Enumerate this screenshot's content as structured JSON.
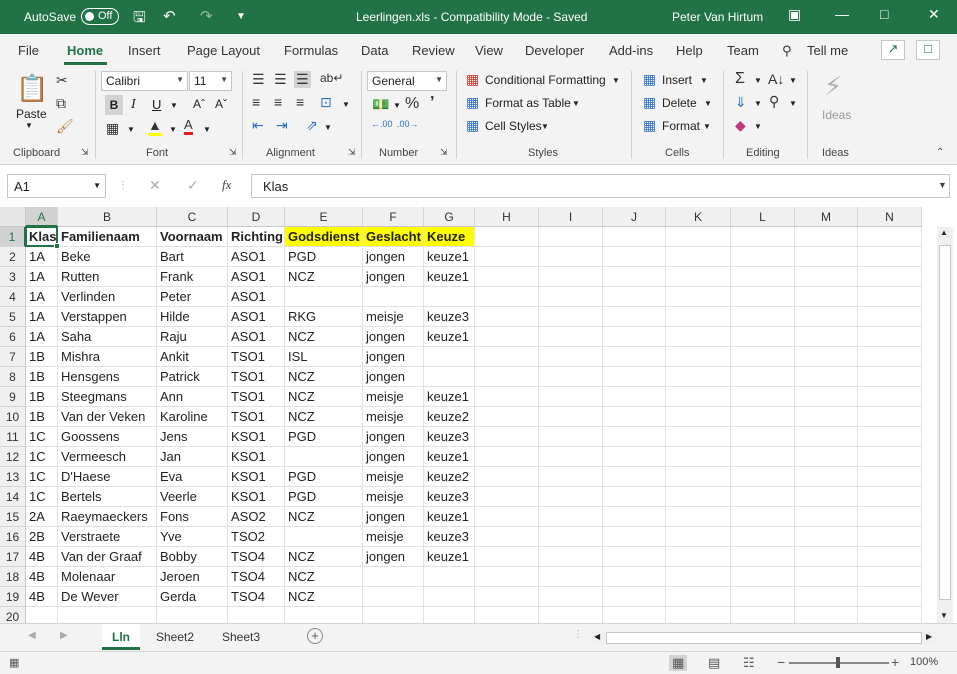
{
  "titlebar": {
    "autosave_label": "AutoSave",
    "autosave_state": "Off",
    "doc_title": "Leerlingen.xls  -  Compatibility Mode  -  Saved",
    "user": "Peter Van Hirtum"
  },
  "tabs": [
    "File",
    "Home",
    "Insert",
    "Page Layout",
    "Formulas",
    "Data",
    "Review",
    "View",
    "Developer",
    "Add-ins",
    "Help",
    "Team"
  ],
  "tell_me": "Tell me",
  "ribbon": {
    "clipboard": {
      "paste": "Paste",
      "label": "Clipboard"
    },
    "font": {
      "name": "Calibri",
      "size": "11",
      "bold": "B",
      "italic": "I",
      "underline": "U",
      "label": "Font"
    },
    "alignment": {
      "label": "Alignment"
    },
    "number": {
      "format": "General",
      "label": "Number"
    },
    "styles": {
      "conditional": "Conditional Formatting",
      "table": "Format as Table",
      "cell": "Cell Styles",
      "label": "Styles"
    },
    "cells": {
      "insert": "Insert",
      "delete": "Delete",
      "format": "Format",
      "label": "Cells"
    },
    "editing": {
      "label": "Editing"
    },
    "ideas": {
      "button": "Ideas",
      "label": "Ideas"
    }
  },
  "formula_bar": {
    "name_box": "A1",
    "content": "Klas"
  },
  "columns": [
    "A",
    "B",
    "C",
    "D",
    "E",
    "F",
    "G",
    "H",
    "I",
    "J",
    "K",
    "L",
    "M",
    "N"
  ],
  "rows": [
    "1",
    "2",
    "3",
    "4",
    "5",
    "6",
    "7",
    "8",
    "9",
    "10",
    "11",
    "12",
    "13",
    "14",
    "15",
    "16",
    "17",
    "18",
    "19",
    "20"
  ],
  "header_row": [
    "Klas",
    "Familienaam",
    "Voornaam",
    "Richting",
    "Godsdienst",
    "Geslacht",
    "Keuze"
  ],
  "data_rows": [
    [
      "1A",
      "Beke",
      "Bart",
      "ASO1",
      "PGD",
      "jongen",
      "keuze1"
    ],
    [
      "1A",
      "Rutten",
      "Frank",
      "ASO1",
      "NCZ",
      "jongen",
      "keuze1"
    ],
    [
      "1A",
      "Verlinden",
      "Peter",
      "ASO1",
      "",
      "",
      ""
    ],
    [
      "1A",
      "Verstappen",
      "Hilde",
      "ASO1",
      "RKG",
      "meisje",
      "keuze3"
    ],
    [
      "1A",
      "Saha",
      "Raju",
      "ASO1",
      "NCZ",
      "jongen",
      "keuze1"
    ],
    [
      "1B",
      "Mishra",
      "Ankit",
      "TSO1",
      "ISL",
      "jongen",
      ""
    ],
    [
      "1B",
      "Hensgens",
      "Patrick",
      "TSO1",
      "NCZ",
      "jongen",
      ""
    ],
    [
      "1B",
      "Steegmans",
      "Ann",
      "TSO1",
      "NCZ",
      "meisje",
      "keuze1"
    ],
    [
      "1B",
      "Van der Veken",
      "Karoline",
      "TSO1",
      "NCZ",
      "meisje",
      "keuze2"
    ],
    [
      "1C",
      "Goossens",
      "Jens",
      "KSO1",
      "PGD",
      "jongen",
      "keuze3"
    ],
    [
      "1C",
      "Vermeesch",
      "Jan",
      "KSO1",
      "",
      "jongen",
      "keuze1"
    ],
    [
      "1C",
      "D'Haese",
      "Eva",
      "KSO1",
      "PGD",
      "meisje",
      "keuze2"
    ],
    [
      "1C",
      "Bertels",
      "Veerle",
      "KSO1",
      "PGD",
      "meisje",
      "keuze3"
    ],
    [
      "2A",
      "Raeymaeckers",
      "Fons",
      "ASO2",
      "NCZ",
      "jongen",
      "keuze1"
    ],
    [
      "2B",
      "Verstraete",
      "Yve",
      "TSO2",
      "",
      "meisje",
      "keuze3"
    ],
    [
      "4B",
      "Van der Graaf",
      "Bobby",
      "TSO4",
      "NCZ",
      "jongen",
      "keuze1"
    ],
    [
      "4B",
      "Molenaar",
      "Jeroen",
      "TSO4",
      "NCZ",
      "",
      ""
    ],
    [
      "4B",
      "De Wever",
      "Gerda",
      "TSO4",
      "NCZ",
      "",
      ""
    ]
  ],
  "sheets": [
    "Lln",
    "Sheet2",
    "Sheet3"
  ],
  "status": {
    "zoom": "100%"
  },
  "colors": {
    "accent": "#217346",
    "highlight": "#ffff00"
  }
}
